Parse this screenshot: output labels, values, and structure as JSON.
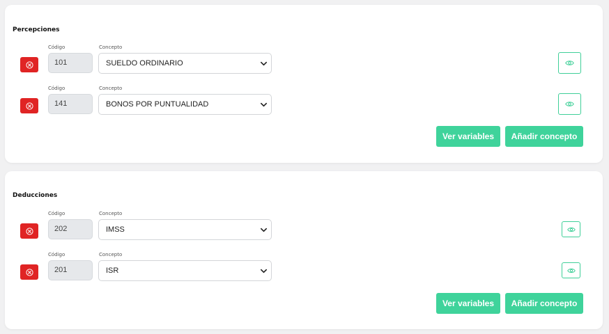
{
  "colors": {
    "accent": "#3fd39b",
    "danger": "#e02424",
    "background": "#f1f1f2",
    "card": "#ffffff"
  },
  "percepciones": {
    "title": "Percepciones",
    "rows": [
      {
        "code_label": "Código",
        "concept_label": "Concepto",
        "code": "101",
        "concept": "SUELDO ORDINARIO"
      },
      {
        "code_label": "Código",
        "concept_label": "Concepto",
        "code": "141",
        "concept": "BONOS POR PUNTUALIDAD"
      }
    ],
    "ver_variables": "Ver variables",
    "anadir_concepto": "Añadir concepto"
  },
  "deducciones": {
    "title": "Deducciones",
    "rows": [
      {
        "code_label": "Código",
        "concept_label": "Concepto",
        "code": "202",
        "concept": "IMSS"
      },
      {
        "code_label": "Código",
        "concept_label": "Concepto",
        "code": "201",
        "concept": "ISR"
      }
    ],
    "ver_variables": "Ver variables",
    "anadir_concepto": "Añadir concepto"
  },
  "icons": {
    "remove": "x-circle-icon",
    "view": "eye-icon",
    "dropdown": "chevron-down-icon"
  }
}
